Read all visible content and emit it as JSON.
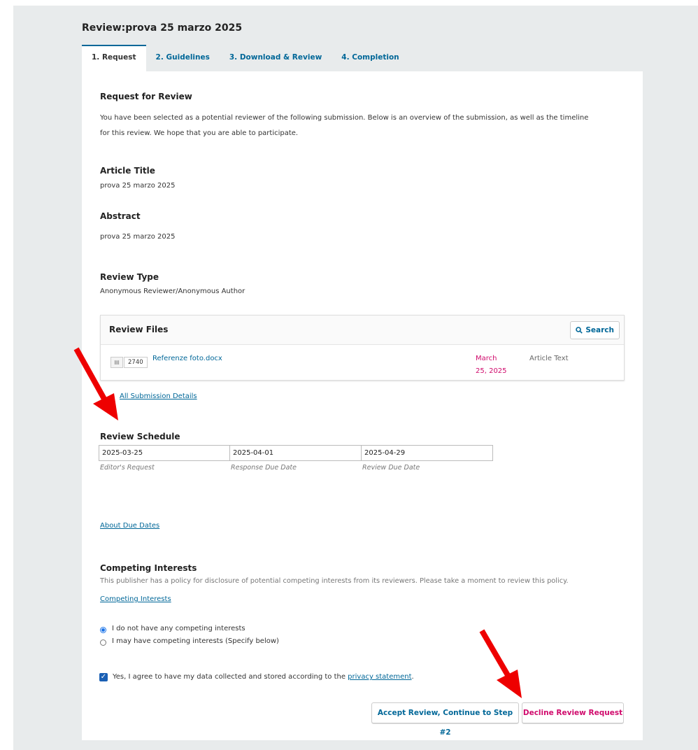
{
  "page": {
    "title": "Review:prova 25 marzo 2025"
  },
  "tabs": [
    {
      "label": "1. Request",
      "active": true
    },
    {
      "label": "2. Guidelines",
      "active": false
    },
    {
      "label": "3. Download & Review",
      "active": false
    },
    {
      "label": "4. Completion",
      "active": false
    }
  ],
  "request": {
    "heading": "Request for Review",
    "intro_line1": "You have been selected as a potential reviewer of the following submission. Below is an overview of the submission, as well as the timeline",
    "intro_line2": "for this review. We hope that you are able to participate."
  },
  "article": {
    "title_label": "Article Title",
    "title_value": "prova 25 marzo 2025"
  },
  "abstract": {
    "label": "Abstract",
    "value": "prova 25 marzo 2025"
  },
  "review_type": {
    "label": "Review Type",
    "value": "Anonymous Reviewer/Anonymous Author"
  },
  "review_files": {
    "heading": "Review Files",
    "search_label": "Search",
    "search_icon": "search-icon",
    "rows": [
      {
        "icon": "file-icon",
        "id": "2740",
        "name": "Referenze foto.docx",
        "date_line1": "March",
        "date_line2": "25, 2025",
        "type": "Article Text"
      }
    ]
  },
  "submission_details_link": "All Submission Details",
  "schedule": {
    "heading": "Review Schedule",
    "editors_request": {
      "value": "2025-03-25",
      "caption": "Editor's Request"
    },
    "response_due": {
      "value": "2025-04-01",
      "caption": "Response Due Date"
    },
    "review_due": {
      "value": "2025-04-29",
      "caption": "Review Due Date"
    }
  },
  "about_due_dates_link": "About Due Dates",
  "competing": {
    "heading": "Competing Interests",
    "text": "This publisher has a policy for disclosure of potential competing interests from its reviewers. Please take a moment to review this policy.",
    "link": "Competing Interests",
    "option_none": "I do not have any competing interests",
    "option_maybe": "I may have competing interests (Specify below)",
    "selected": "none"
  },
  "consent": {
    "text_before": "Yes, I agree to have my data collected and stored according to the ",
    "link": "privacy statement",
    "text_after": ".",
    "checked": true
  },
  "actions": {
    "accept": "Accept Review, Continue to Step #2",
    "decline": "Decline Review Request"
  },
  "colors": {
    "accent": "#006798",
    "danger": "#d00a6c",
    "annotation_arrow": "#ee0000"
  }
}
